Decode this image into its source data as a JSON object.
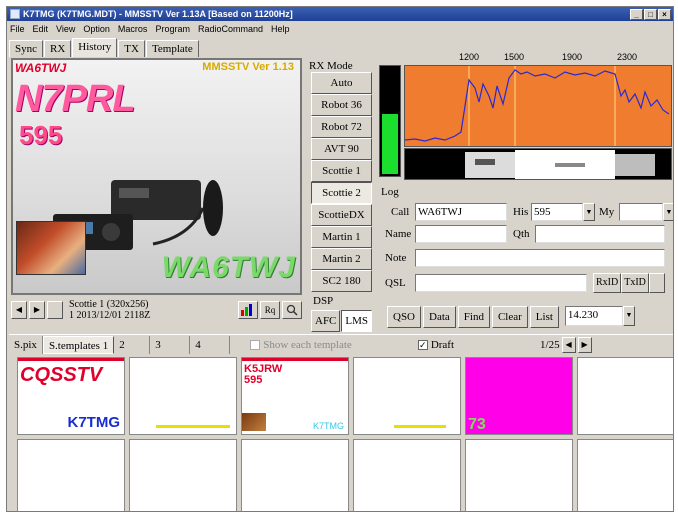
{
  "window": {
    "title": "K7TMG (K7TMG.MDT) - MMSSTV Ver 1.13A [Based on 11200Hz]",
    "controls": [
      "_",
      "□",
      "×"
    ]
  },
  "menu": [
    "File",
    "Edit",
    "View",
    "Option",
    "Macros",
    "Program",
    "RadioCommand",
    "Help"
  ],
  "top_tabs": [
    {
      "label": "Sync",
      "active": false
    },
    {
      "label": "RX",
      "active": false
    },
    {
      "label": "History",
      "active": true
    },
    {
      "label": "TX",
      "active": false
    },
    {
      "label": "Template",
      "active": false
    }
  ],
  "image": {
    "header_callsign": "WA6TWJ",
    "header_version": "MMSSTV Ver 1.13",
    "big_callsign": "N7PRL",
    "rst": "595",
    "footer_callsign": "WA6TWJ"
  },
  "image_status": {
    "line1": "Scottie 1 (320x256)",
    "line2": "1 2013/12/01 2118Z",
    "prev_icon": "left-arrow-icon",
    "next_icon": "right-arrow-icon"
  },
  "rx_mode": {
    "label": "RX Mode",
    "buttons": [
      "Auto",
      "Robot 36",
      "Robot 72",
      "AVT 90",
      "Scottie 1",
      "Scottie 2",
      "ScottieDX",
      "Martin 1",
      "Martin 2",
      "SC2 180"
    ],
    "active": "Scottie 2"
  },
  "dsp": {
    "label": "DSP",
    "afc": "AFC",
    "lms": "LMS"
  },
  "spectrum": {
    "freq_labels": [
      "1200",
      "1500",
      "1900",
      "2300"
    ],
    "level": 0.55
  },
  "log": {
    "label": "Log",
    "call_label": "Call",
    "call_value": "WA6TWJ",
    "his_label": "His",
    "his_value": "595",
    "my_label": "My",
    "my_value": "",
    "name_label": "Name",
    "name_value": "",
    "qth_label": "Qth",
    "qth_value": "",
    "note_label": "Note",
    "note_value": "",
    "qsl_label": "QSL",
    "qsl_value": "",
    "rxid_label": "RxID",
    "txid_label": "TxID",
    "freq_value": "14.230"
  },
  "log_buttons": [
    "QSO",
    "Data",
    "Find",
    "Clear",
    "List"
  ],
  "bottom_tabs": [
    {
      "label": "S.pix",
      "active": false
    },
    {
      "label": "S.templates 1",
      "active": true
    },
    {
      "label": "2",
      "active": false
    },
    {
      "label": "3",
      "active": false
    },
    {
      "label": "4",
      "active": false
    }
  ],
  "options": {
    "show_templates": "Show each template",
    "draft": "Draft"
  },
  "pager": {
    "count": "1/25"
  },
  "templates": [
    {
      "cq": "CQSSTV",
      "call": "K7TMG"
    },
    {
      "call": "K5JRW",
      "rst": "595",
      "small": "K7TMG"
    },
    {
      "number": "73"
    }
  ],
  "colors": {
    "title_bar": "#1e3f96",
    "spectrum": "#f07c30",
    "meter": "#1cde2c",
    "magenta_template": "#ff00e8"
  }
}
